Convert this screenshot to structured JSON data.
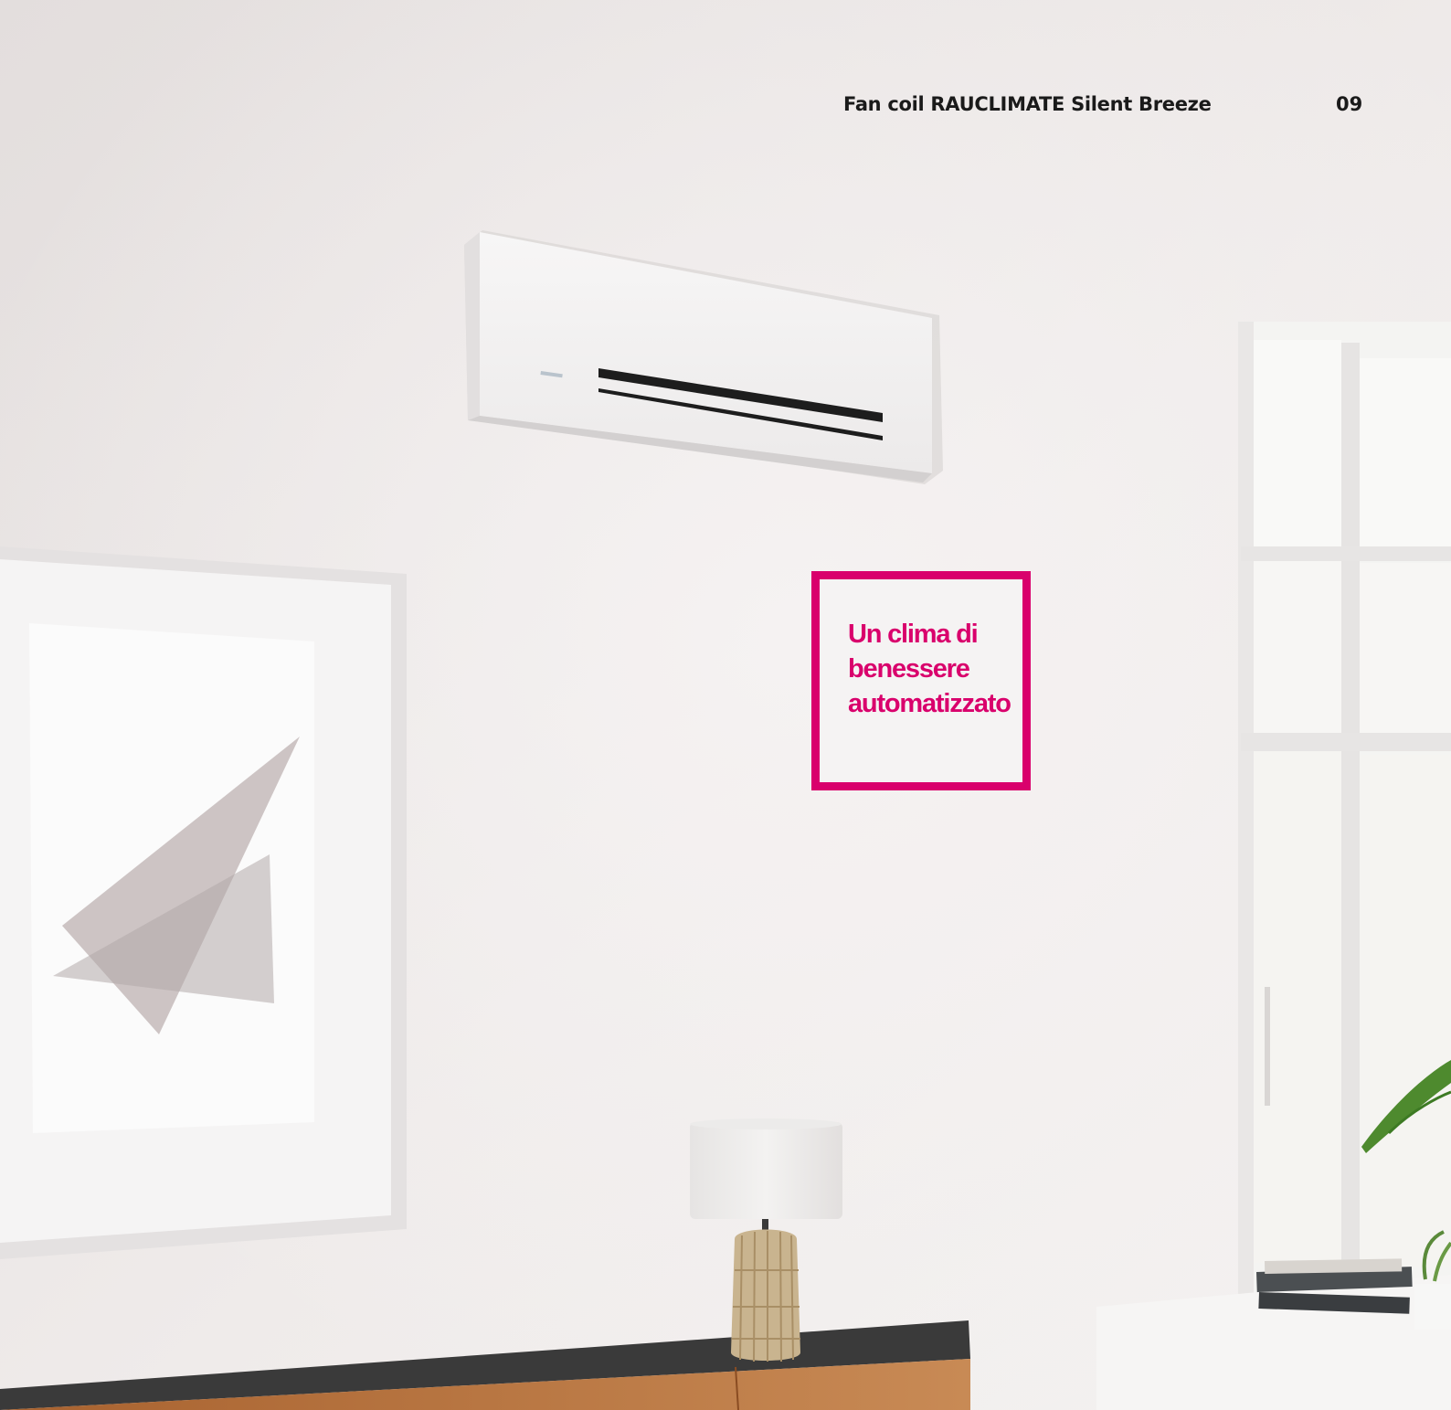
{
  "header": {
    "title": "Fan coil RAUCLIMATE Silent Breeze",
    "page_number": "09"
  },
  "callout": {
    "lines": [
      "Un clima di",
      "benessere",
      "automatizzato"
    ]
  },
  "colors": {
    "accent": "#d9006c",
    "wall": "#e8e4e3",
    "text": "#1a1a1a"
  },
  "illustration": {
    "icons": [
      "fan-coil-unit",
      "framed-art",
      "window",
      "table-lamp",
      "sideboard",
      "plant",
      "books"
    ]
  }
}
